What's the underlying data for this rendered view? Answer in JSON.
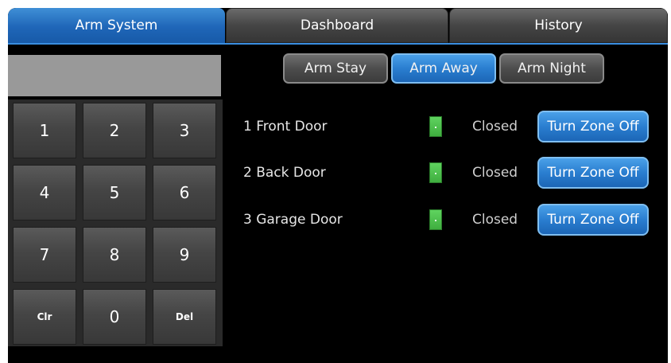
{
  "tabs": [
    {
      "label": "Arm System",
      "active": true
    },
    {
      "label": "Dashboard",
      "active": false
    },
    {
      "label": "History",
      "active": false
    }
  ],
  "keypad": {
    "display_value": "",
    "keys": [
      "1",
      "2",
      "3",
      "4",
      "5",
      "6",
      "7",
      "8",
      "9",
      "Clr",
      "0",
      "Del"
    ]
  },
  "arm_modes": [
    {
      "label": "Arm Stay",
      "selected": false
    },
    {
      "label": "Arm Away",
      "selected": true
    },
    {
      "label": "Arm Night",
      "selected": false
    }
  ],
  "zones": [
    {
      "label": "1  Front Door",
      "status": "Closed",
      "action": "Turn Zone Off"
    },
    {
      "label": "2  Back Door",
      "status": "Closed",
      "action": "Turn Zone Off"
    },
    {
      "label": "3  Garage Door",
      "status": "Closed",
      "action": "Turn Zone Off"
    }
  ],
  "colors": {
    "accent": "#2a7ed0",
    "zone_ok": "#4cc24c",
    "background": "#000000"
  }
}
